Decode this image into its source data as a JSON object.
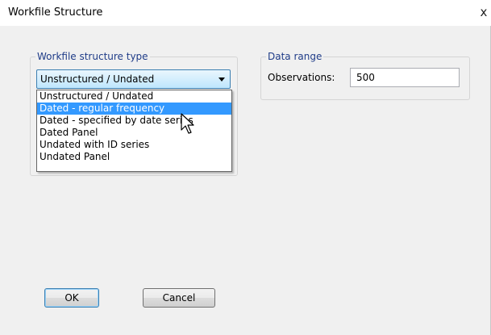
{
  "window": {
    "title": "Workfile Structure",
    "close_glyph": "x"
  },
  "structure_group": {
    "legend": "Workfile structure type",
    "selected_value": "Unstructured / Undated",
    "options": [
      "Unstructured / Undated",
      "Dated - regular frequency",
      "Dated - specified by date series",
      "Dated Panel",
      "Undated with ID series",
      "Undated Panel"
    ],
    "highlighted_index": 1
  },
  "data_range": {
    "legend": "Data range",
    "observations_label": "Observations:",
    "observations_value": "500"
  },
  "buttons": {
    "ok": "OK",
    "cancel": "Cancel"
  },
  "colors": {
    "highlight": "#3399ff",
    "legend_text": "#1f3c88",
    "dialog_bg": "#f0f0f0"
  },
  "icons": {
    "cursor": "mouse-pointer-icon",
    "dropdown": "chevron-down-icon"
  }
}
